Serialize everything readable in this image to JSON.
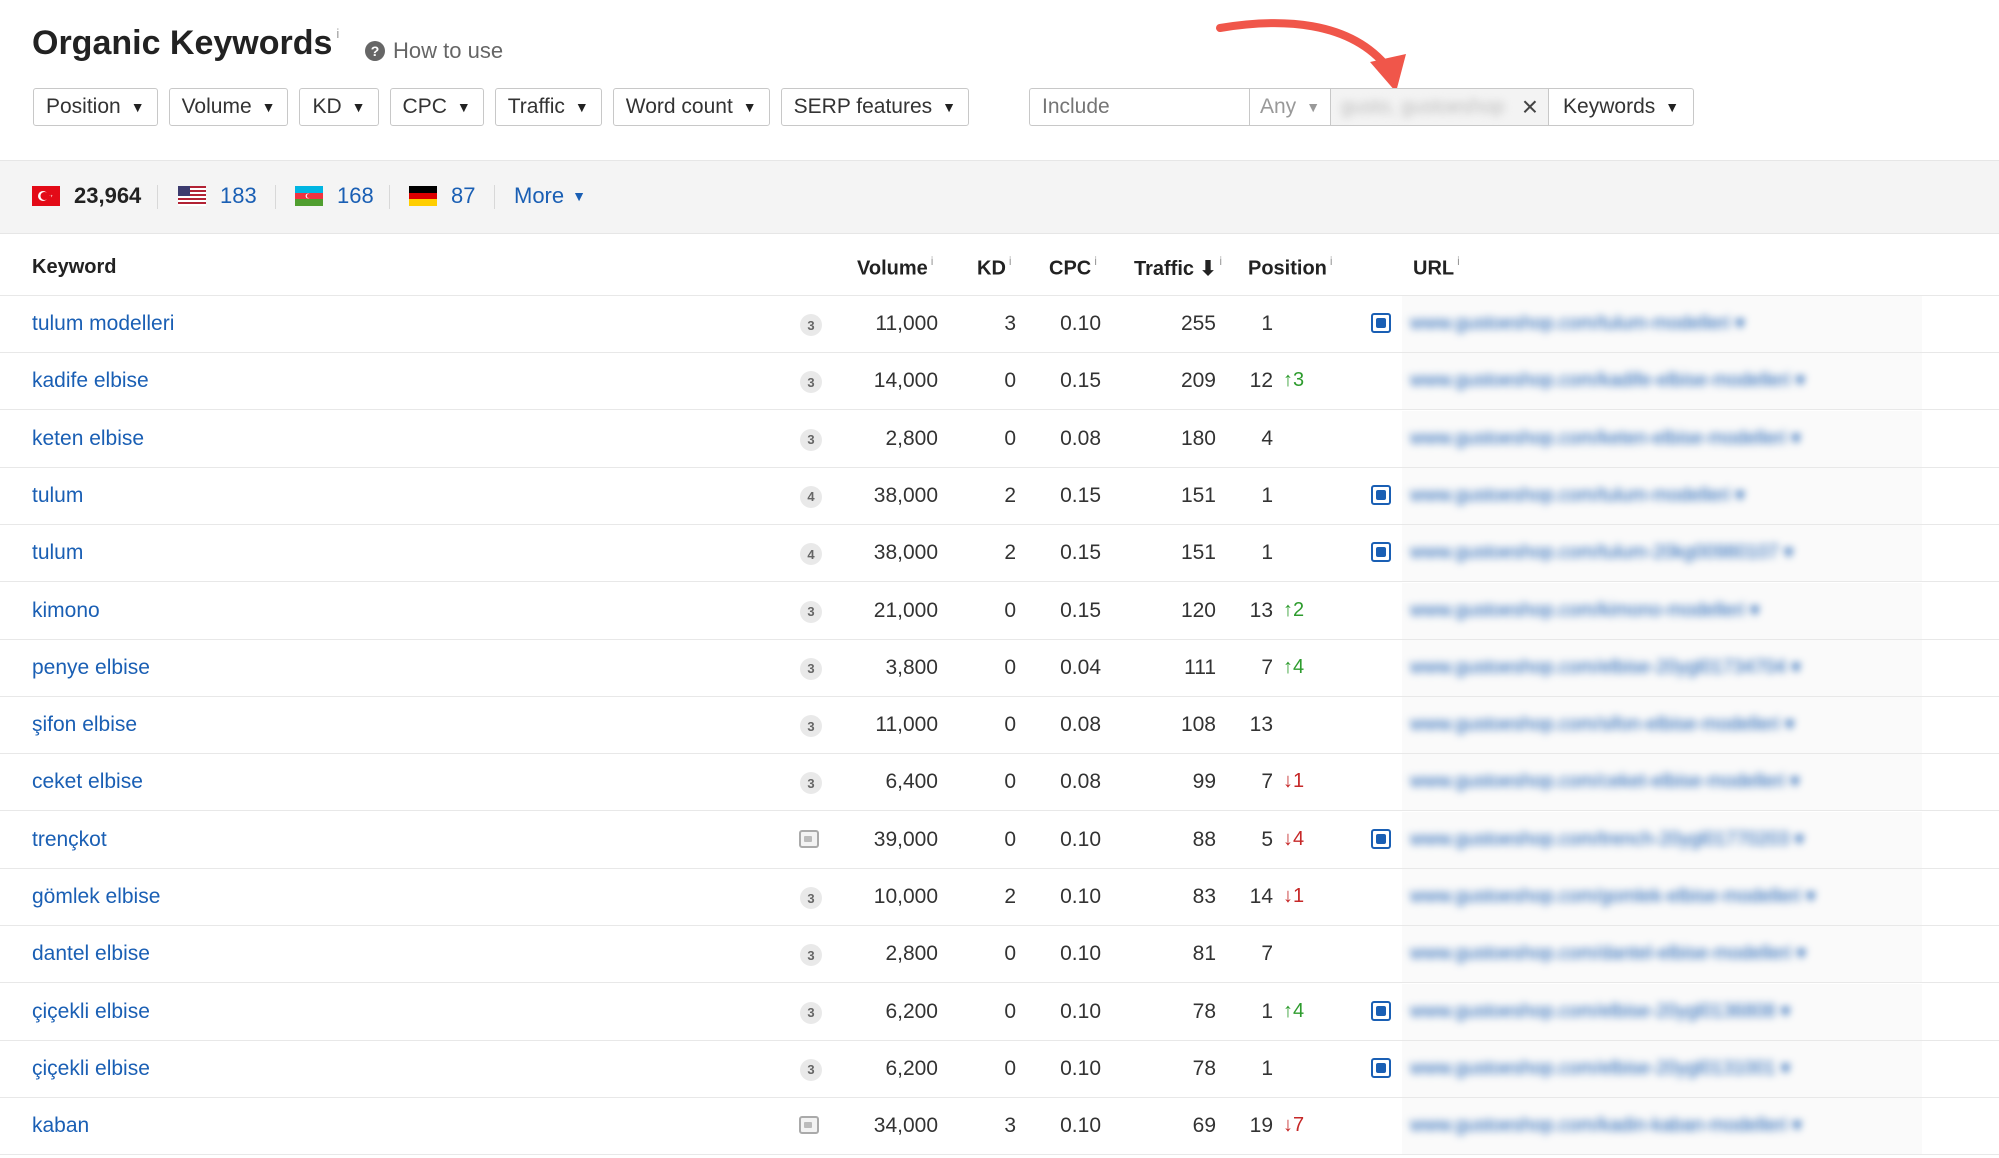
{
  "header": {
    "title": "Organic Keywords",
    "title_info": "i",
    "how_to_use": "How to use"
  },
  "filters": {
    "position": "Position",
    "volume": "Volume",
    "kd": "KD",
    "cpc": "CPC",
    "traffic": "Traffic",
    "word_count": "Word count",
    "serp_features": "SERP features",
    "include_placeholder": "Include",
    "any": "Any",
    "chip_text": "gusto, gustoeshop",
    "keywords": "Keywords"
  },
  "countries": [
    {
      "code": "TR",
      "count": "23,964",
      "active": true
    },
    {
      "code": "US",
      "count": "183"
    },
    {
      "code": "AZ",
      "count": "168"
    },
    {
      "code": "DE",
      "count": "87"
    }
  ],
  "more_label": "More",
  "table": {
    "headers": {
      "keyword": "Keyword",
      "volume": "Volume",
      "kd": "KD",
      "cpc": "CPC",
      "traffic": "Traffic",
      "position": "Position",
      "url": "URL"
    },
    "rows": [
      {
        "keyword": "tulum modelleri",
        "serp": "3",
        "volume": "11,000",
        "kd": "3",
        "cpc": "0.10",
        "traffic": "255",
        "position": "1",
        "change": "",
        "dir": "",
        "image": true,
        "url": "www.gustoeshop.com/tulum-modelleri ▾"
      },
      {
        "keyword": "kadife elbise",
        "serp": "3",
        "volume": "14,000",
        "kd": "0",
        "cpc": "0.15",
        "traffic": "209",
        "position": "12",
        "change": "↑3",
        "dir": "up",
        "image": false,
        "url": "www.gustoeshop.com/kadife-elbise-modelleri ▾"
      },
      {
        "keyword": "keten elbise",
        "serp": "3",
        "volume": "2,800",
        "kd": "0",
        "cpc": "0.08",
        "traffic": "180",
        "position": "4",
        "change": "",
        "dir": "",
        "image": false,
        "url": "www.gustoeshop.com/keten-elbise-modelleri ▾"
      },
      {
        "keyword": "tulum",
        "serp": "4",
        "volume": "38,000",
        "kd": "2",
        "cpc": "0.15",
        "traffic": "151",
        "position": "1",
        "change": "",
        "dir": "",
        "image": true,
        "url": "www.gustoeshop.com/tulum-modelleri ▾"
      },
      {
        "keyword": "tulum",
        "serp": "4",
        "volume": "38,000",
        "kd": "2",
        "cpc": "0.15",
        "traffic": "151",
        "position": "1",
        "change": "",
        "dir": "",
        "image": true,
        "url": "www.gustoeshop.com/tulum-20kg00980107 ▾"
      },
      {
        "keyword": "kimono",
        "serp": "3",
        "volume": "21,000",
        "kd": "0",
        "cpc": "0.15",
        "traffic": "120",
        "position": "13",
        "change": "↑2",
        "dir": "up",
        "image": false,
        "url": "www.gustoeshop.com/kimono-modelleri ▾"
      },
      {
        "keyword": "penye elbise",
        "serp": "3",
        "volume": "3,800",
        "kd": "0",
        "cpc": "0.04",
        "traffic": "111",
        "position": "7",
        "change": "↑4",
        "dir": "up",
        "image": false,
        "url": "www.gustoeshop.com/elbise-20ygl01734704 ▾"
      },
      {
        "keyword": "şifon elbise",
        "serp": "3",
        "volume": "11,000",
        "kd": "0",
        "cpc": "0.08",
        "traffic": "108",
        "position": "13",
        "change": "",
        "dir": "",
        "image": false,
        "url": "www.gustoeshop.com/sifon-elbise-modelleri ▾"
      },
      {
        "keyword": "ceket elbise",
        "serp": "3",
        "volume": "6,400",
        "kd": "0",
        "cpc": "0.08",
        "traffic": "99",
        "position": "7",
        "change": "↓1",
        "dir": "down",
        "image": false,
        "url": "www.gustoeshop.com/ceket-elbise-modelleri ▾"
      },
      {
        "keyword": "trençkot",
        "serp": "img",
        "volume": "39,000",
        "kd": "0",
        "cpc": "0.10",
        "traffic": "88",
        "position": "5",
        "change": "↓4",
        "dir": "down",
        "image": true,
        "url": "www.gustoeshop.com/trench-20ygl01770203 ▾"
      },
      {
        "keyword": "gömlek elbise",
        "serp": "3",
        "volume": "10,000",
        "kd": "2",
        "cpc": "0.10",
        "traffic": "83",
        "position": "14",
        "change": "↓1",
        "dir": "down",
        "image": false,
        "url": "www.gustoeshop.com/gomlek-elbise-modelleri ▾"
      },
      {
        "keyword": "dantel elbise",
        "serp": "3",
        "volume": "2,800",
        "kd": "0",
        "cpc": "0.10",
        "traffic": "81",
        "position": "7",
        "change": "",
        "dir": "",
        "image": false,
        "url": "www.gustoeshop.com/dantel-elbise-modelleri ▾"
      },
      {
        "keyword": "çiçekli elbise",
        "serp": "3",
        "volume": "6,200",
        "kd": "0",
        "cpc": "0.10",
        "traffic": "78",
        "position": "1",
        "change": "↑4",
        "dir": "up",
        "image": true,
        "url": "www.gustoeshop.com/elbise-20ygl0136808 ▾"
      },
      {
        "keyword": "çiçekli elbise",
        "serp": "3",
        "volume": "6,200",
        "kd": "0",
        "cpc": "0.10",
        "traffic": "78",
        "position": "1",
        "change": "",
        "dir": "",
        "image": true,
        "url": "www.gustoeshop.com/elbise-20ygl0131001 ▾"
      },
      {
        "keyword": "kaban",
        "serp": "img",
        "volume": "34,000",
        "kd": "3",
        "cpc": "0.10",
        "traffic": "69",
        "position": "19",
        "change": "↓7",
        "dir": "down",
        "image": false,
        "url": "www.gustoeshop.com/kadin-kaban-modelleri ▾"
      }
    ]
  },
  "colors": {
    "link": "#1a5fb4",
    "up": "#2e9c2e",
    "down": "#c62828",
    "annotation_arrow": "#f0564a"
  }
}
